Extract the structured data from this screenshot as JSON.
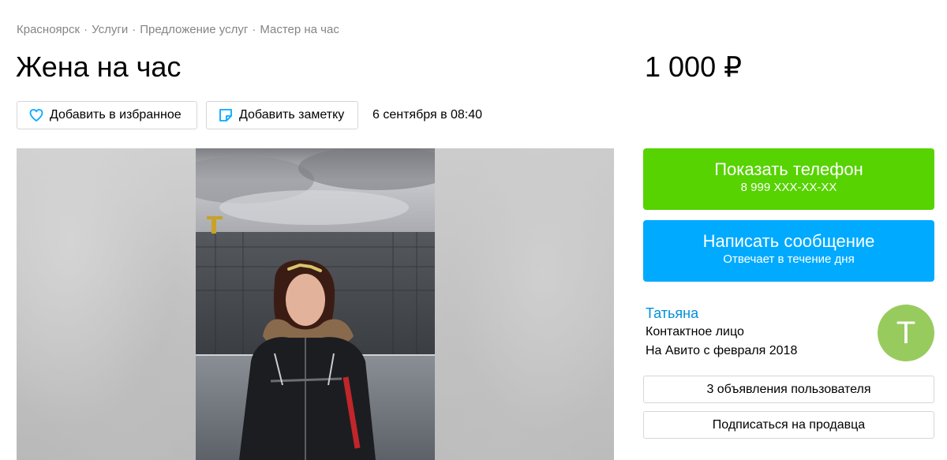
{
  "breadcrumbs": [
    {
      "label": "Красноярск"
    },
    {
      "label": "Услуги"
    },
    {
      "label": "Предложение услуг"
    },
    {
      "label": "Мастер на час"
    }
  ],
  "breadcrumb_separator": "·",
  "listing": {
    "title": "Жена на час",
    "price": "1 000 ₽",
    "date": "6 сентября в 08:40"
  },
  "actions": {
    "favorite_label": "Добавить в избранное",
    "favorite_icon": "heart-icon",
    "note_label": "Добавить заметку",
    "note_icon": "note-icon"
  },
  "contact": {
    "phone_button_label": "Показать телефон",
    "phone_masked": "8 999 XXX-XX-XX",
    "message_button_label": "Написать сообщение",
    "message_subtitle": "Отвечает в течение дня"
  },
  "seller": {
    "name": "Татьяна",
    "role": "Контактное лицо",
    "since": "На Авито с февраля 2018",
    "avatar_letter": "Т",
    "ads_button_label": "3 объявления пользователя",
    "subscribe_button_label": "Подписаться на продавца"
  },
  "colors": {
    "phone_button": "#56d300",
    "message_button": "#00aaff",
    "seller_link": "#0091d9",
    "avatar": "#98cb5e",
    "breadcrumb_text": "#858585"
  }
}
